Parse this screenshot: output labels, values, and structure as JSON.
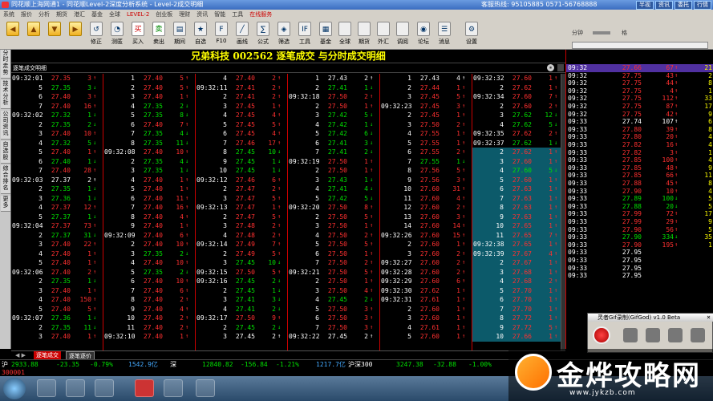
{
  "window": {
    "title": "同花顺上海网通1 - 同花顺Level-2深度分析系统 - Level-2成交明细",
    "hotline": "客服热线: 95105885 0571-56768888",
    "buttons": [
      "半视",
      "资讯",
      "委托",
      "行情"
    ]
  },
  "menubar": {
    "items": [
      "系统",
      "报价",
      "分析",
      "期货",
      "港汇",
      "基金",
      "全球",
      "LEVEL-2",
      "创业板",
      "理财",
      "资讯",
      "智能",
      "工具",
      "在线服务"
    ]
  },
  "toolbar": {
    "buttons": [
      {
        "label": "",
        "icon": "◀"
      },
      {
        "label": "",
        "icon": "▲"
      },
      {
        "label": "",
        "icon": "▼"
      },
      {
        "label": "",
        "icon": "▶"
      },
      {
        "label": "修正",
        "icon": "↺"
      },
      {
        "label": "测匿",
        "icon": "◔"
      },
      {
        "label": "买入",
        "icon": "买"
      },
      {
        "label": "卖出",
        "icon": "卖"
      },
      {
        "label": "期间",
        "icon": "▤"
      },
      {
        "label": "自选",
        "icon": "★"
      },
      {
        "label": "F10",
        "icon": "F"
      },
      {
        "label": "画线",
        "icon": "╱"
      },
      {
        "label": "公式",
        "icon": "∑"
      },
      {
        "label": "筛选",
        "icon": "◈"
      },
      {
        "label": "工具",
        "icon": "IF"
      },
      {
        "label": "基金",
        "icon": "▦"
      },
      {
        "label": "全球",
        "icon": ""
      },
      {
        "label": "期货",
        "icon": ""
      },
      {
        "label": "外汇",
        "icon": ""
      },
      {
        "label": "调阅",
        "icon": ""
      },
      {
        "label": "论坛",
        "icon": "◉"
      },
      {
        "label": "消息",
        "icon": "☰"
      },
      {
        "label": "设置",
        "icon": "⚙"
      }
    ],
    "right_label": "分钟",
    "right_label2": "10",
    "right_label3": "格"
  },
  "sidebar": {
    "tabs": [
      "分时走势",
      "技术分析",
      "公司资讯",
      "自选股",
      "综合排名",
      "更多"
    ]
  },
  "headline": "兄弟科技 002562 逐笔成交 与分时成交明细",
  "subheader": "逐笔成交明细",
  "columns": [
    [
      [
        "09:32:01",
        "27.35",
        "3",
        "u"
      ],
      [
        "5",
        "27.35",
        "3",
        "d"
      ],
      [
        "6",
        "27.40",
        "3",
        "u"
      ],
      [
        "7",
        "27.40",
        "16",
        "u"
      ],
      [
        "09:32:02",
        "27.32",
        "1",
        "d"
      ],
      [
        "2",
        "27.35",
        "2",
        "d"
      ],
      [
        "3",
        "27.40",
        "10",
        "u"
      ],
      [
        "4",
        "27.32",
        "5",
        "d"
      ],
      [
        "5",
        "27.40",
        "1",
        "u"
      ],
      [
        "6",
        "27.40",
        "1",
        "d"
      ],
      [
        "7",
        "27.40",
        "28",
        "u"
      ],
      [
        "09:32:03",
        "27.37",
        "2",
        "w"
      ],
      [
        "2",
        "27.35",
        "1",
        "d"
      ],
      [
        "3",
        "27.36",
        "1",
        "d"
      ],
      [
        "4",
        "27.37",
        "12",
        "u"
      ],
      [
        "5",
        "27.37",
        "1",
        "d"
      ],
      [
        "09:32:04",
        "27.37",
        "73",
        "u"
      ],
      [
        "2",
        "27.37",
        "31",
        "d"
      ],
      [
        "3",
        "27.40",
        "22",
        "u"
      ],
      [
        "4",
        "27.40",
        "1",
        "u"
      ],
      [
        "5",
        "27.40",
        "1",
        "u"
      ],
      [
        "09:32:06",
        "27.40",
        "2",
        "u"
      ],
      [
        "2",
        "27.35",
        "1",
        "d"
      ],
      [
        "3",
        "27.40",
        "1",
        "u"
      ],
      [
        "4",
        "27.40",
        "150",
        "u"
      ],
      [
        "5",
        "27.40",
        "5",
        "u"
      ],
      [
        "09:32:07",
        "27.36",
        "1",
        "d"
      ],
      [
        "2",
        "27.35",
        "11",
        "d"
      ],
      [
        "3",
        "27.40",
        "1",
        "u"
      ]
    ],
    [
      [
        "1",
        "27.40",
        "5",
        "u"
      ],
      [
        "2",
        "27.40",
        "5",
        "u"
      ],
      [
        "3",
        "27.40",
        "1",
        "u"
      ],
      [
        "4",
        "27.35",
        "2",
        "d"
      ],
      [
        "5",
        "27.35",
        "8",
        "d"
      ],
      [
        "6",
        "27.40",
        "7",
        "u"
      ],
      [
        "7",
        "27.35",
        "4",
        "d"
      ],
      [
        "8",
        "27.35",
        "11",
        "d"
      ],
      [
        "09:32:08",
        "27.40",
        "10",
        "u"
      ],
      [
        "2",
        "27.35",
        "4",
        "d"
      ],
      [
        "3",
        "27.35",
        "1",
        "d"
      ],
      [
        "4",
        "27.40",
        "1",
        "u"
      ],
      [
        "5",
        "27.40",
        "1",
        "u"
      ],
      [
        "6",
        "27.40",
        "11",
        "u"
      ],
      [
        "7",
        "27.40",
        "16",
        "u"
      ],
      [
        "8",
        "27.40",
        "4",
        "u"
      ],
      [
        "9",
        "27.40",
        "1",
        "u"
      ],
      [
        "09:32:09",
        "27.40",
        "6",
        "u"
      ],
      [
        "2",
        "27.40",
        "10",
        "u"
      ],
      [
        "3",
        "27.35",
        "2",
        "d"
      ],
      [
        "4",
        "27.40",
        "10",
        "u"
      ],
      [
        "5",
        "27.35",
        "2",
        "d"
      ],
      [
        "6",
        "27.40",
        "10",
        "u"
      ],
      [
        "7",
        "27.40",
        "6",
        "u"
      ],
      [
        "8",
        "27.40",
        "2",
        "u"
      ],
      [
        "9",
        "27.40",
        "4",
        "u"
      ],
      [
        "10",
        "27.40",
        "2",
        "u"
      ],
      [
        "11",
        "27.40",
        "2",
        "u"
      ],
      [
        "09:32:10",
        "27.40",
        "1",
        "u"
      ]
    ],
    [
      [
        "4",
        "27.40",
        "2",
        "u"
      ],
      [
        "09:32:11",
        "27.41",
        "2",
        "u"
      ],
      [
        "2",
        "27.41",
        "2",
        "u"
      ],
      [
        "3",
        "27.45",
        "1",
        "u"
      ],
      [
        "4",
        "27.45",
        "4",
        "u"
      ],
      [
        "5",
        "27.45",
        "5",
        "u"
      ],
      [
        "6",
        "27.45",
        "4",
        "u"
      ],
      [
        "7",
        "27.46",
        "17",
        "u"
      ],
      [
        "8",
        "27.45",
        "10",
        "d"
      ],
      [
        "9",
        "27.45",
        "1",
        "d"
      ],
      [
        "10",
        "27.45",
        "1",
        "d"
      ],
      [
        "09:32:12",
        "27.46",
        "6",
        "u"
      ],
      [
        "2",
        "27.47",
        "2",
        "u"
      ],
      [
        "3",
        "27.47",
        "5",
        "u"
      ],
      [
        "09:32:13",
        "27.47",
        "1",
        "u"
      ],
      [
        "2",
        "27.47",
        "5",
        "u"
      ],
      [
        "3",
        "27.48",
        "2",
        "u"
      ],
      [
        "4",
        "27.48",
        "2",
        "u"
      ],
      [
        "09:32:14",
        "27.49",
        "7",
        "u"
      ],
      [
        "2",
        "27.49",
        "5",
        "u"
      ],
      [
        "3",
        "27.45",
        "10",
        "d"
      ],
      [
        "09:32:15",
        "27.50",
        "5",
        "u"
      ],
      [
        "09:32:16",
        "27.45",
        "2",
        "d"
      ],
      [
        "2",
        "27.45",
        "1",
        "d"
      ],
      [
        "3",
        "27.41",
        "3",
        "d"
      ],
      [
        "4",
        "27.41",
        "2",
        "d"
      ],
      [
        "09:32:17",
        "27.50",
        "9",
        "u"
      ],
      [
        "2",
        "27.45",
        "2",
        "d"
      ],
      [
        "3",
        "27.45",
        "2",
        "w"
      ]
    ],
    [
      [
        "1",
        "27.43",
        "2",
        "w"
      ],
      [
        "2",
        "27.41",
        "1",
        "d"
      ],
      [
        "09:32:18",
        "27.50",
        "2",
        "u"
      ],
      [
        "2",
        "27.50",
        "1",
        "u"
      ],
      [
        "3",
        "27.42",
        "5",
        "d"
      ],
      [
        "4",
        "27.42",
        "1",
        "d"
      ],
      [
        "5",
        "27.42",
        "6",
        "d"
      ],
      [
        "6",
        "27.41",
        "3",
        "d"
      ],
      [
        "7",
        "27.41",
        "2",
        "d"
      ],
      [
        "09:32:19",
        "27.50",
        "1",
        "u"
      ],
      [
        "2",
        "27.50",
        "1",
        "u"
      ],
      [
        "3",
        "27.43",
        "1",
        "d"
      ],
      [
        "4",
        "27.41",
        "4",
        "d"
      ],
      [
        "5",
        "27.42",
        "5",
        "d"
      ],
      [
        "09:32:20",
        "27.50",
        "8",
        "u"
      ],
      [
        "2",
        "27.50",
        "5",
        "u"
      ],
      [
        "3",
        "27.50",
        "1",
        "u"
      ],
      [
        "4",
        "27.50",
        "2",
        "u"
      ],
      [
        "5",
        "27.50",
        "5",
        "u"
      ],
      [
        "6",
        "27.50",
        "1",
        "u"
      ],
      [
        "7",
        "27.50",
        "2",
        "u"
      ],
      [
        "09:32:21",
        "27.50",
        "5",
        "u"
      ],
      [
        "2",
        "27.50",
        "1",
        "u"
      ],
      [
        "3",
        "27.50",
        "4",
        "u"
      ],
      [
        "4",
        "27.45",
        "2",
        "d"
      ],
      [
        "5",
        "27.50",
        "3",
        "u"
      ],
      [
        "6",
        "27.50",
        "3",
        "u"
      ],
      [
        "7",
        "27.50",
        "3",
        "u"
      ],
      [
        "09:32:22",
        "27.45",
        "2",
        "w"
      ]
    ],
    [
      [
        "1",
        "27.43",
        "4",
        "w"
      ],
      [
        "2",
        "27.44",
        "1",
        "u"
      ],
      [
        "3",
        "27.45",
        "5",
        "u"
      ],
      [
        "09:32:23",
        "27.45",
        "3",
        "u"
      ],
      [
        "2",
        "27.45",
        "1",
        "u"
      ],
      [
        "3",
        "27.50",
        "2",
        "u"
      ],
      [
        "4",
        "27.55",
        "1",
        "u"
      ],
      [
        "5",
        "27.55",
        "1",
        "u"
      ],
      [
        "6",
        "27.55",
        "2",
        "u"
      ],
      [
        "7",
        "27.55",
        "1",
        "d"
      ],
      [
        "8",
        "27.56",
        "5",
        "u"
      ],
      [
        "9",
        "27.56",
        "3",
        "u"
      ],
      [
        "10",
        "27.60",
        "31",
        "u"
      ],
      [
        "11",
        "27.60",
        "4",
        "u"
      ],
      [
        "12",
        "27.60",
        "2",
        "u"
      ],
      [
        "13",
        "27.60",
        "3",
        "u"
      ],
      [
        "14",
        "27.60",
        "14",
        "u"
      ],
      [
        "09:32:26",
        "27.60",
        "15",
        "u"
      ],
      [
        "2",
        "27.60",
        "1",
        "u"
      ],
      [
        "3",
        "27.60",
        "2",
        "u"
      ],
      [
        "09:32:27",
        "27.60",
        "2",
        "u"
      ],
      [
        "09:32:28",
        "27.60",
        "2",
        "u"
      ],
      [
        "09:32:29",
        "27.60",
        "6",
        "u"
      ],
      [
        "09:32:30",
        "27.62",
        "1",
        "u"
      ],
      [
        "09:32:31",
        "27.61",
        "1",
        "u"
      ],
      [
        "2",
        "27.60",
        "1",
        "u"
      ],
      [
        "3",
        "27.60",
        "1",
        "u"
      ],
      [
        "4",
        "27.61",
        "1",
        "u"
      ],
      [
        "5",
        "27.60",
        "1",
        "u"
      ]
    ],
    [
      [
        "09:32:32",
        "27.60",
        "1",
        "u"
      ],
      [
        "2",
        "27.62",
        "1",
        "u"
      ],
      [
        "09:32:34",
        "27.60",
        "7",
        "u"
      ],
      [
        "2",
        "27.60",
        "2",
        "u"
      ],
      [
        "3",
        "27.62",
        "12",
        "d"
      ],
      [
        "4",
        "27.62",
        "5",
        "d"
      ],
      [
        "09:32:35",
        "27.62",
        "2",
        "u"
      ],
      [
        "09:32:37",
        "27.62",
        "1",
        "d"
      ],
      [
        "2",
        "27.62",
        "1",
        "u"
      ],
      [
        "3",
        "27.60",
        "1",
        "u"
      ],
      [
        "4",
        "27.60",
        "5",
        "d"
      ],
      [
        "5",
        "27.60",
        "1",
        "u"
      ],
      [
        "6",
        "27.63",
        "1",
        "u"
      ],
      [
        "7",
        "27.63",
        "1",
        "u"
      ],
      [
        "8",
        "27.63",
        "1",
        "u"
      ],
      [
        "9",
        "27.63",
        "1",
        "u"
      ],
      [
        "10",
        "27.65",
        "1",
        "u"
      ],
      [
        "11",
        "27.65",
        "7",
        "u"
      ],
      [
        "09:32:38",
        "27.65",
        "1",
        "u"
      ],
      [
        "09:32:39",
        "27.67",
        "4",
        "u"
      ],
      [
        "2",
        "27.67",
        "1",
        "u"
      ],
      [
        "3",
        "27.68",
        "1",
        "u"
      ],
      [
        "4",
        "27.68",
        "2",
        "u"
      ],
      [
        "5",
        "27.70",
        "1",
        "u"
      ],
      [
        "6",
        "27.70",
        "1",
        "u"
      ],
      [
        "7",
        "27.70",
        "1",
        "u"
      ],
      [
        "8",
        "27.72",
        "1",
        "u"
      ],
      [
        "9",
        "27.72",
        "5",
        "u"
      ],
      [
        "10",
        "27.66",
        "1",
        "u"
      ]
    ]
  ],
  "bottom_tabs": [
    "逐笔成交",
    "逐笔逐价"
  ],
  "right_list": {
    "header": "",
    "rows": [
      [
        "09:32",
        "27.66",
        "67",
        "u",
        "21"
      ],
      [
        "09:32",
        "27.75",
        "43",
        "u",
        "2"
      ],
      [
        "09:32",
        "27.75",
        "44",
        "u",
        "8"
      ],
      [
        "09:32",
        "27.75",
        "4",
        "u",
        "1"
      ],
      [
        "09:32",
        "27.75",
        "112",
        "u",
        "33"
      ],
      [
        "09:32",
        "27.75",
        "87",
        "u",
        "17"
      ],
      [
        "09:32",
        "27.75",
        "42",
        "u",
        "9"
      ],
      [
        "09:33",
        "27.74",
        "107",
        "w",
        "6"
      ],
      [
        "09:33",
        "27.80",
        "39",
        "u",
        "8"
      ],
      [
        "09:33",
        "27.80",
        "20",
        "u",
        "4"
      ],
      [
        "09:33",
        "27.82",
        "16",
        "u",
        "4"
      ],
      [
        "09:33",
        "27.82",
        "3",
        "u",
        "1"
      ],
      [
        "09:33",
        "27.85",
        "100",
        "u",
        "4"
      ],
      [
        "09:33",
        "27.85",
        "48",
        "u",
        "9"
      ],
      [
        "09:33",
        "27.85",
        "66",
        "u",
        "11"
      ],
      [
        "09:33",
        "27.88",
        "45",
        "u",
        "8"
      ],
      [
        "09:33",
        "27.90",
        "10",
        "u",
        "4"
      ],
      [
        "09:33",
        "27.89",
        "100",
        "d",
        "5"
      ],
      [
        "09:33",
        "27.88",
        "20",
        "d",
        "5"
      ],
      [
        "09:33",
        "27.99",
        "72",
        "u",
        "17"
      ],
      [
        "09:33",
        "27.99",
        "29",
        "u",
        "9"
      ],
      [
        "09:33",
        "27.90",
        "56",
        "u",
        "5"
      ],
      [
        "09:33",
        "27.90",
        "334",
        "d",
        "35"
      ],
      [
        "09:33",
        "27.90",
        "195",
        "u",
        "1"
      ],
      [
        "09:33",
        "27.95",
        "",
        "",
        ""
      ],
      [
        "09:33",
        "27.95",
        "",
        "",
        ""
      ],
      [
        "09:33",
        "27.95",
        "",
        "",
        ""
      ],
      [
        "09:33",
        "27.95",
        "",
        "",
        ""
      ]
    ]
  },
  "gif_window": {
    "title": "灵者Gif录制(GifGod) v1.0 Beta",
    "close": "×"
  },
  "status": {
    "sh_label": "沪",
    "sh_index": "2933.88",
    "sh_change": "-23.35",
    "sh_pct": "-0.79%",
    "sh_amount": "1542.9亿",
    "sz_label": "深",
    "sz_index": "12840.82",
    "sz_change": "-156.84",
    "sz_pct": "-1.21%",
    "sz_amount": "1217.7亿",
    "hs300_label": "沪深300",
    "hs300_index": "3247.38",
    "hs300_change": "-32.88",
    "hs300_pct": "-1.00%"
  },
  "status2": "300001",
  "watermark": {
    "text": "金烨攻略网",
    "url": "www.jykzb.com"
  }
}
